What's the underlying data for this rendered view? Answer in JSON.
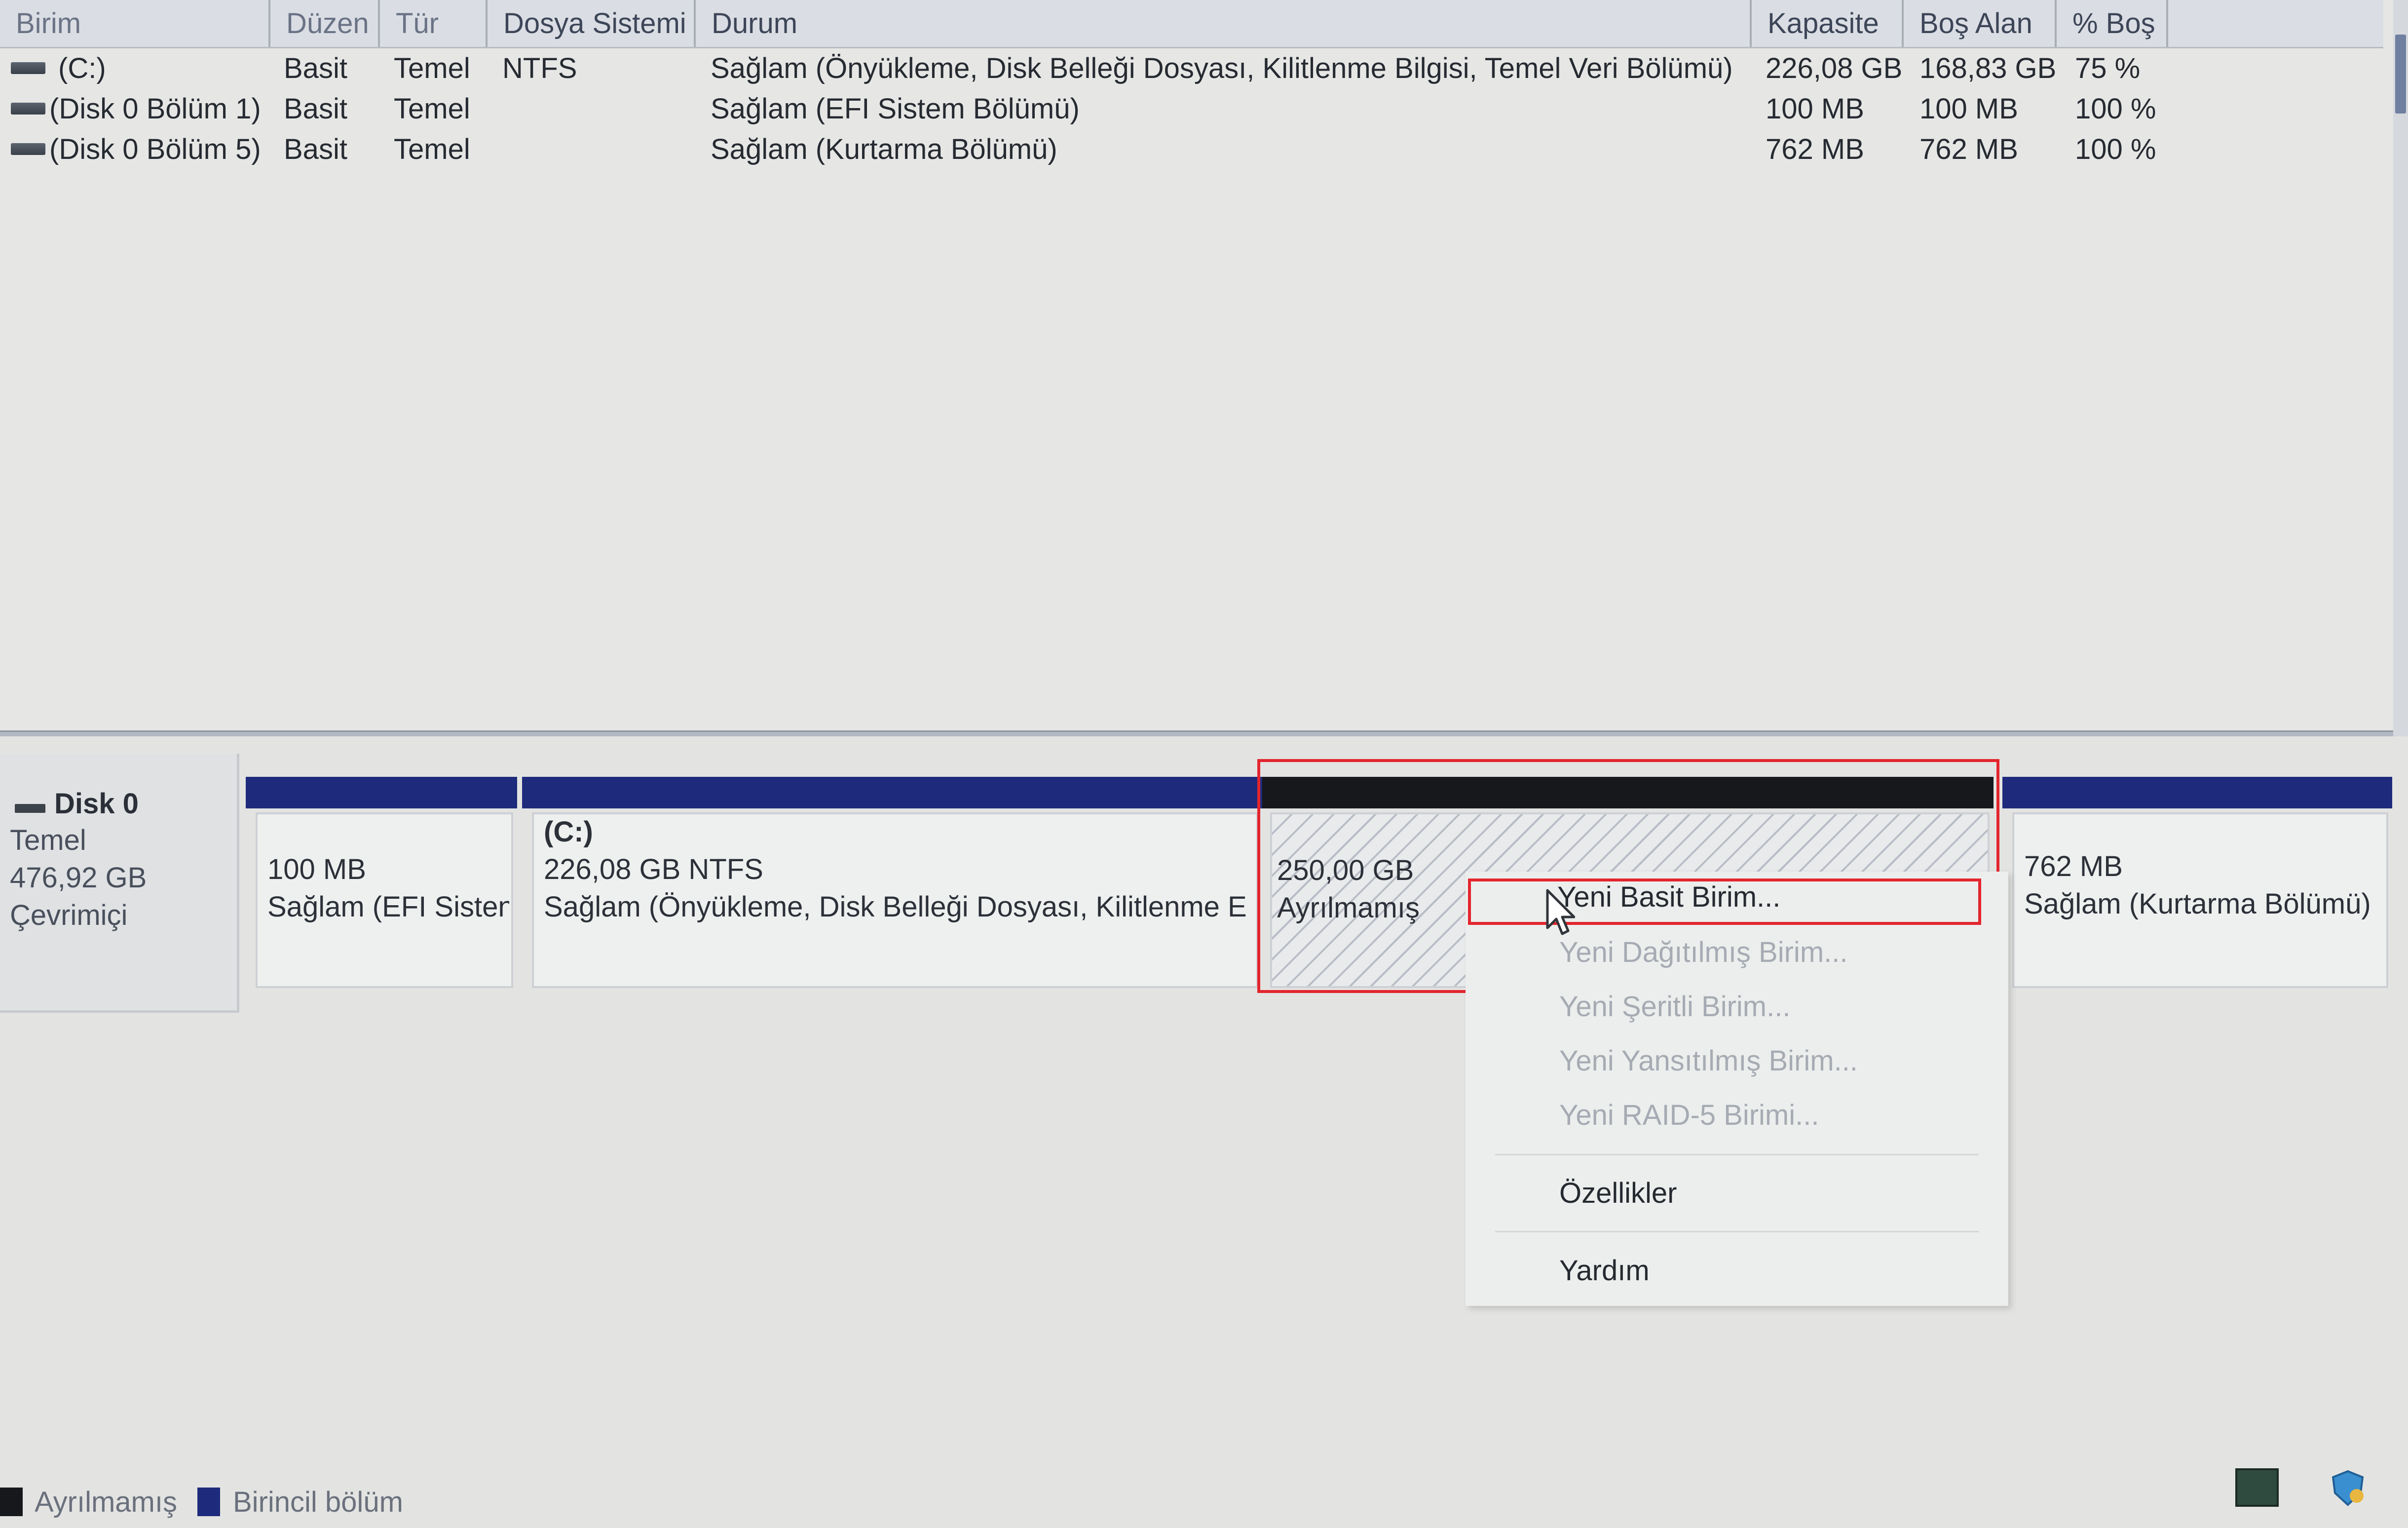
{
  "colors": {
    "primary_partition": "#1e2b7c",
    "unallocated": "#16181c",
    "highlight_box": "#e3252e"
  },
  "volume_list": {
    "columns": [
      "Birim",
      "Düzen",
      "Tür",
      "Dosya Sistemi",
      "Durum",
      "Kapasite",
      "Boş Alan",
      "% Boş"
    ],
    "rows": [
      {
        "name": "(C:)",
        "layout": "Basit",
        "type": "Temel",
        "fs": "NTFS",
        "status": "Sağlam (Önyükleme, Disk Belleği Dosyası, Kilitlenme Bilgisi, Temel Veri Bölümü)",
        "capacity": "226,08 GB",
        "free": "168,83 GB",
        "pct": "75 %"
      },
      {
        "name": "(Disk 0 Bölüm 1)",
        "layout": "Basit",
        "type": "Temel",
        "fs": "",
        "status": "Sağlam (EFI Sistem Bölümü)",
        "capacity": "100 MB",
        "free": "100 MB",
        "pct": "100 %"
      },
      {
        "name": "(Disk 0 Bölüm 5)",
        "layout": "Basit",
        "type": "Temel",
        "fs": "",
        "status": "Sağlam (Kurtarma Bölümü)",
        "capacity": "762 MB",
        "free": "762 MB",
        "pct": "100 %"
      }
    ]
  },
  "disk": {
    "title": "Disk 0",
    "kind": "Temel",
    "size": "476,92 GB",
    "state": "Çevrimiçi",
    "partitions": [
      {
        "line1": "100 MB",
        "line2": "Sağlam (EFI Sisten"
      },
      {
        "label": "(C:)",
        "line1": "226,08 GB NTFS",
        "line2": "Sağlam (Önyükleme, Disk Belleği Dosyası, Kilitlenme E"
      },
      {
        "line1": "250,00 GB",
        "line2": "Ayrılmamış"
      },
      {
        "line1": "762 MB",
        "line2": "Sağlam (Kurtarma Bölümü)"
      }
    ]
  },
  "context_menu": {
    "items": [
      {
        "label": "Yeni Basit Birim...",
        "enabled": true
      },
      {
        "label": "Yeni Dağıtılmış Birim...",
        "enabled": false
      },
      {
        "label": "Yeni Şeritli Birim...",
        "enabled": false
      },
      {
        "label": "Yeni Yansıtılmış Birim...",
        "enabled": false
      },
      {
        "label": "Yeni RAID-5 Birimi...",
        "enabled": false
      },
      {
        "label": "Özellikler",
        "enabled": true
      },
      {
        "label": "Yardım",
        "enabled": true
      }
    ]
  },
  "legend": {
    "unallocated": "Ayrılmamış",
    "primary": "Birincil bölüm"
  }
}
